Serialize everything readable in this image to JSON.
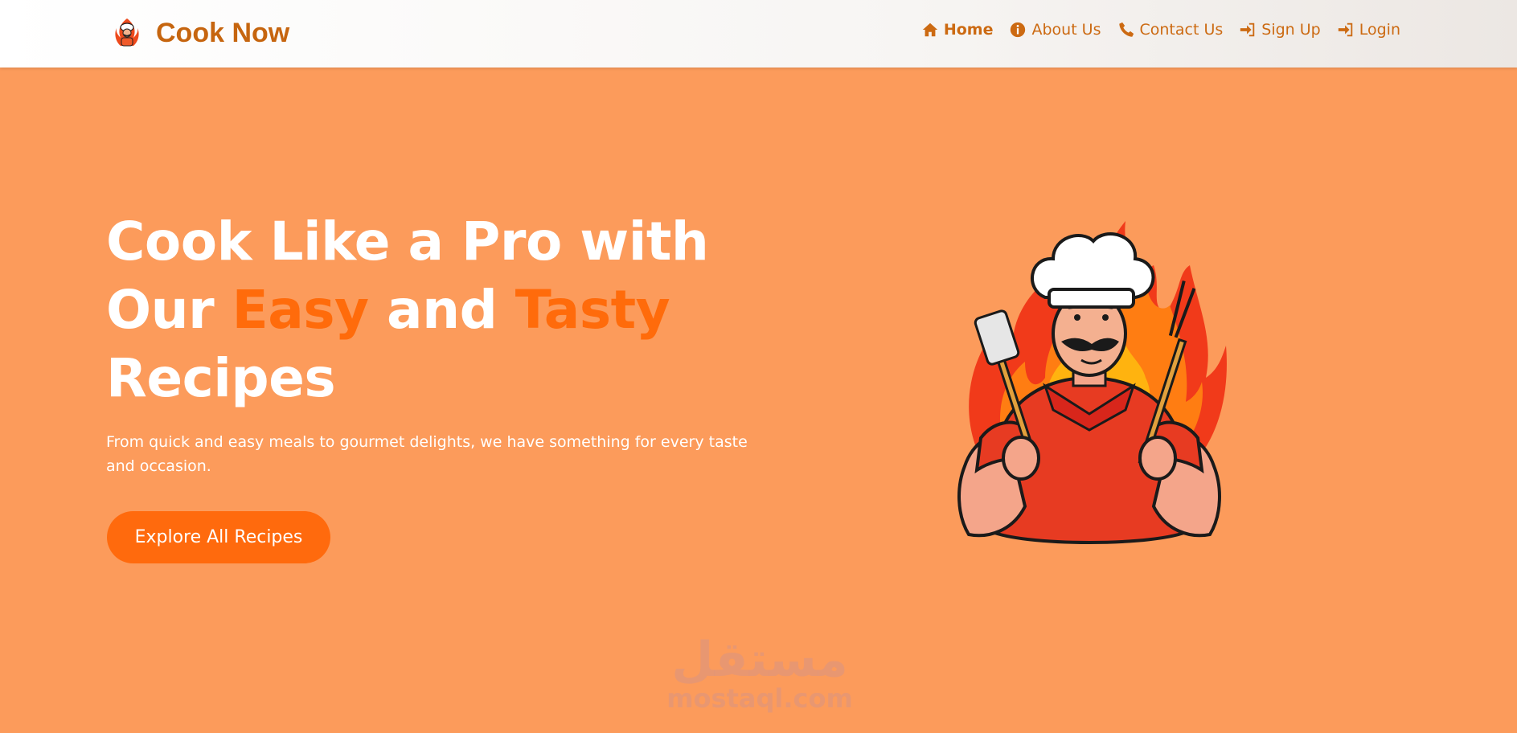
{
  "brand": {
    "name": "Cook Now",
    "logo_icon": "chef-logo-icon"
  },
  "nav": {
    "items": [
      {
        "label": "Home",
        "icon": "home-icon",
        "active": true
      },
      {
        "label": "About Us",
        "icon": "info-icon",
        "active": false
      },
      {
        "label": "Contact Us",
        "icon": "phone-icon",
        "active": false
      },
      {
        "label": "Sign Up",
        "icon": "sign-in-icon",
        "active": false
      },
      {
        "label": "Login",
        "icon": "sign-in-icon",
        "active": false
      }
    ]
  },
  "hero": {
    "title_part1": "Cook Like a Pro with Our ",
    "title_highlight1": "Easy",
    "title_part2": " and ",
    "title_highlight2": "Tasty",
    "title_part3": " Recipes",
    "subtitle": "From quick and easy meals to gourmet delights, we have something for every taste and occasion.",
    "cta_label": "Explore All Recipes",
    "illustration": "chef-illustration"
  },
  "watermark": {
    "arabic": "مستقل",
    "latin": "mostaql.com"
  },
  "colors": {
    "background": "#fc9b5b",
    "accent": "#ff6b0b",
    "nav_text": "#cc6a12",
    "brand": "#c6650f"
  }
}
